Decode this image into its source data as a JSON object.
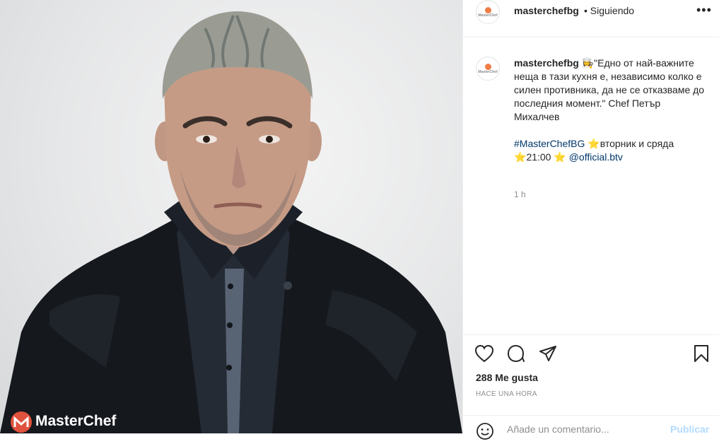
{
  "post": {
    "username": "masterchefbg",
    "follow_status": "• Siguiendo",
    "more": "•••",
    "avatar_text": "MasterChef",
    "caption": {
      "emoji": "👩‍🍳",
      "text": "\"Едно от най-важните неща в тази кухня е, независимо колко е силен противника, да не се отказваме до последния момент.\" Chef Петър Михалчев",
      "hashtag": "#MasterChefBG",
      "star": "⭐",
      "line2": "вторник и сряда",
      "time_text": "21:00",
      "mention": "@official.btv"
    },
    "posted": "1 h",
    "likes": "288 Me gusta",
    "ago": "HACE UNA HORA",
    "comment_placeholder": "Añade un comentario...",
    "publish_label": "Publicar"
  },
  "photo": {
    "watermark": "MasterChef",
    "colors": {
      "background": "#e3e4e5",
      "jacket": "#15181d",
      "shirt": "#252b35",
      "logo": "#e0523d"
    }
  }
}
